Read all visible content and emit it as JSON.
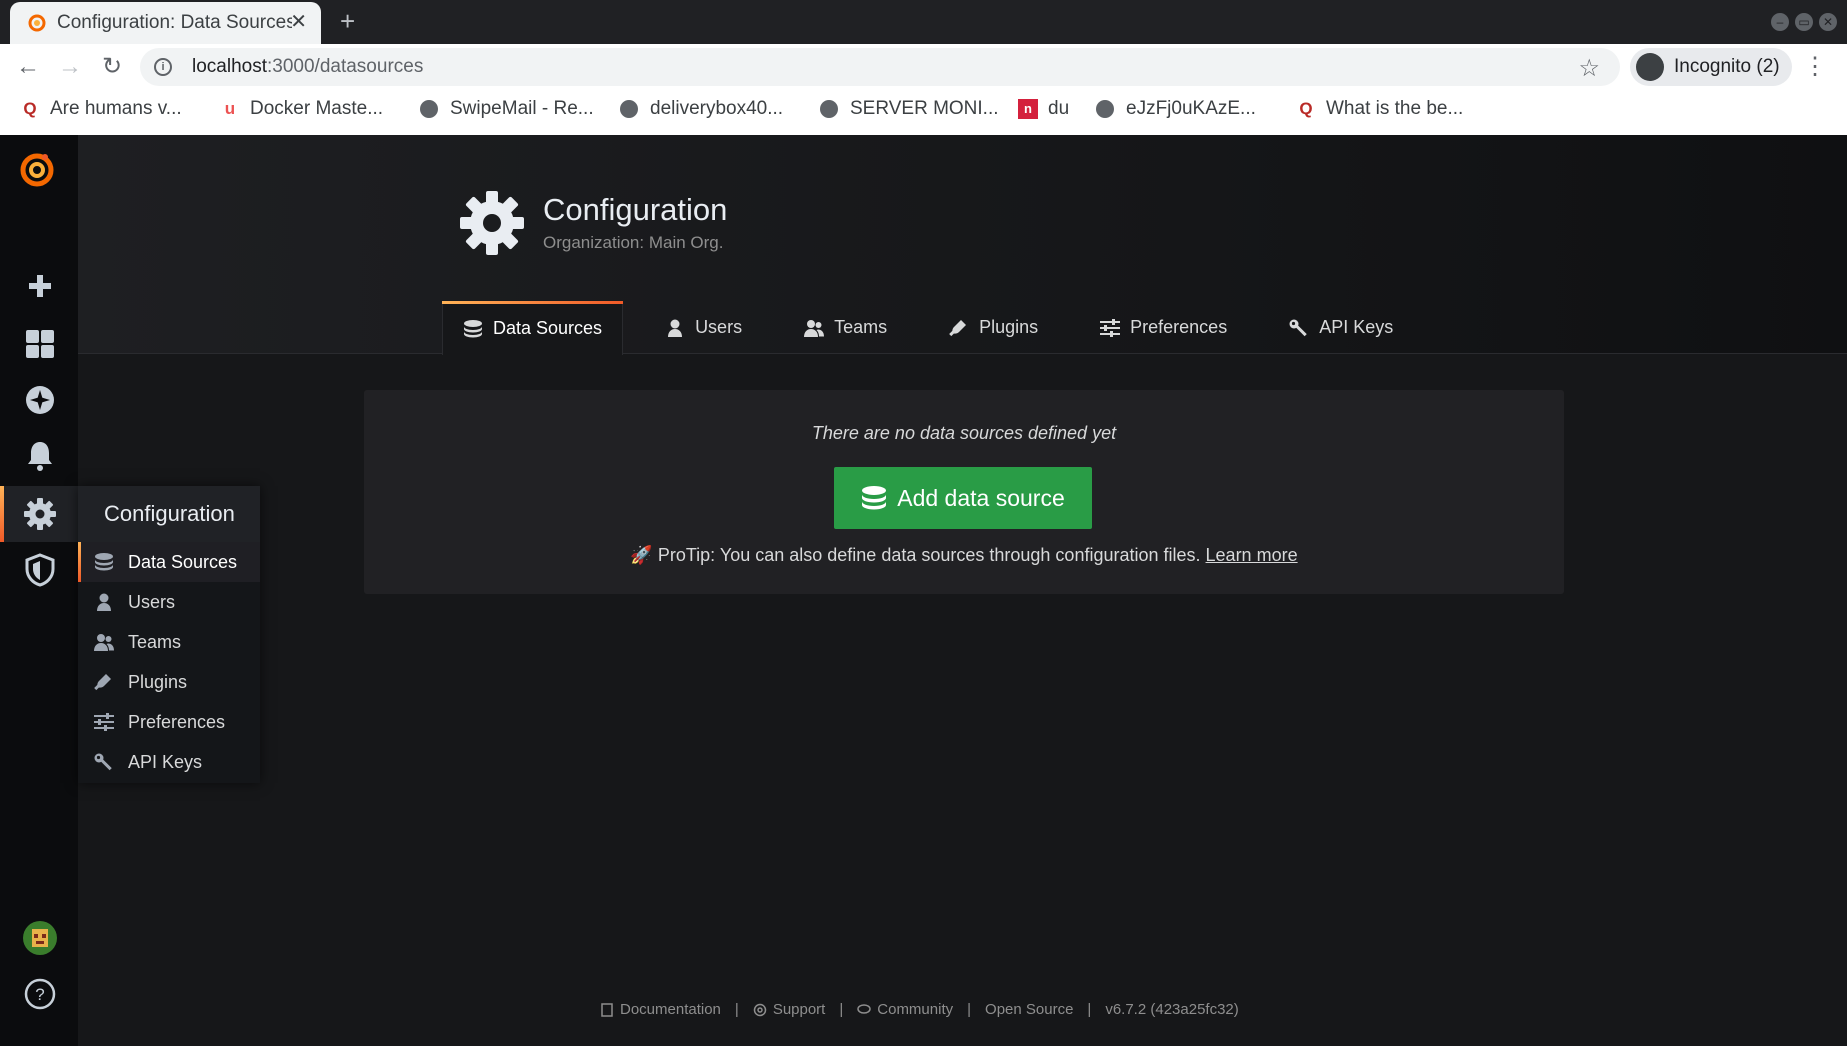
{
  "browser": {
    "tab_title": "Configuration: Data Sources - Grafana",
    "new_tab": "+",
    "url_host": "localhost",
    "url_path": ":3000/datasources",
    "profile": "Incognito (2)",
    "bookmarks": [
      {
        "label": "Are humans v...",
        "icon": "quora-icon"
      },
      {
        "label": "Docker Maste...",
        "icon": "udemy-icon"
      },
      {
        "label": "SwipeMail - Re...",
        "icon": "globe-icon"
      },
      {
        "label": "deliverybox40...",
        "icon": "globe-icon"
      },
      {
        "label": "SERVER MONI...",
        "icon": "globe-icon"
      },
      {
        "label": "du",
        "icon": "du-icon"
      },
      {
        "label": "eJzFj0uKAzE...",
        "icon": "globe-icon"
      },
      {
        "label": "What is the be...",
        "icon": "quora-icon"
      }
    ]
  },
  "header": {
    "title": "Configuration",
    "subtitle": "Organization: Main Org."
  },
  "tabs": [
    {
      "label": "Data Sources",
      "icon": "database-icon",
      "active": true
    },
    {
      "label": "Users",
      "icon": "user-icon"
    },
    {
      "label": "Teams",
      "icon": "users-icon"
    },
    {
      "label": "Plugins",
      "icon": "plug-icon"
    },
    {
      "label": "Preferences",
      "icon": "sliders-icon"
    },
    {
      "label": "API Keys",
      "icon": "key-icon"
    }
  ],
  "sidemenu": {
    "dropdown_title": "Configuration",
    "items": [
      {
        "label": "Data Sources",
        "active": true
      },
      {
        "label": "Users"
      },
      {
        "label": "Teams"
      },
      {
        "label": "Plugins"
      },
      {
        "label": "Preferences"
      },
      {
        "label": "API Keys"
      }
    ]
  },
  "empty": {
    "message": "There are no data sources defined yet",
    "button": "Add data source",
    "protip": "ProTip: You can also define data sources through configuration files.",
    "learn_more": "Learn more"
  },
  "footer": {
    "documentation": "Documentation",
    "support": "Support",
    "community": "Community",
    "open_source": "Open Source",
    "version": "v6.7.2 (423a25fc32)"
  },
  "colors": {
    "accent_start": "#ffb357",
    "accent_end": "#f05a28",
    "primary_button": "#299c46",
    "background": "#161719",
    "sidebar": "#0b0c0e"
  }
}
